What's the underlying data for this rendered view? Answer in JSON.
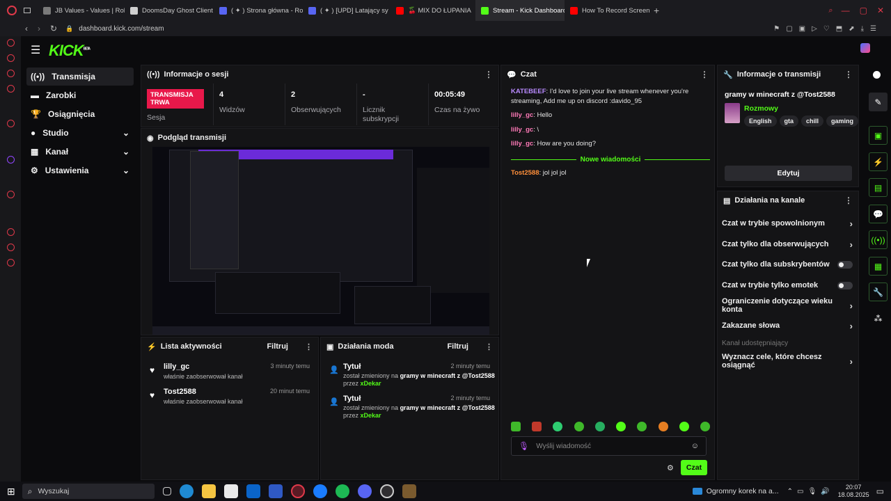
{
  "browser": {
    "tabs": [
      {
        "label": "JB Values - Values | Robl",
        "color": "#7a7a7a"
      },
      {
        "label": "DoomsDay Ghost Client",
        "color": "#cfcfcf"
      },
      {
        "label": "( ✦ ) Strona główna - Rob",
        "color": "#5865f2"
      },
      {
        "label": "( ✦ ) [UPD] Latający sy",
        "color": "#5865f2"
      },
      {
        "label": "🍒 MIX DO ŁUPANIA",
        "color": "#ff0000"
      },
      {
        "label": "Stream - Kick Dashboard",
        "color": "#53fc18"
      },
      {
        "label": "How To Record Screen W",
        "color": "#ff0000"
      }
    ],
    "url": "dashboard.kick.com/stream"
  },
  "app": {
    "logo": "KICK",
    "logo_sup": "BETA"
  },
  "sidebar": {
    "items": [
      {
        "label": "Transmisja"
      },
      {
        "label": "Zarobki"
      },
      {
        "label": "Osiągnięcia"
      },
      {
        "label": "Studio"
      },
      {
        "label": "Kanał"
      },
      {
        "label": "Ustawienia"
      }
    ]
  },
  "session": {
    "title": "Informacje o sesji",
    "live_badge": "TRANSMISJA TRWA",
    "session_label": "Sesja",
    "stats": [
      {
        "value": "4",
        "label": "Widzów"
      },
      {
        "value": "2",
        "label": "Obserwujących"
      },
      {
        "value": "-",
        "label": "Licznik subskrypcji"
      },
      {
        "value": "00:05:49",
        "label": "Czas na żywo"
      }
    ]
  },
  "preview": {
    "title": "Podgląd transmisji"
  },
  "activity": {
    "title": "Lista aktywności",
    "filter": "Filtruj",
    "items": [
      {
        "name": "lilly_gc",
        "desc": "właśnie zaobserwował kanał",
        "time": "3 minuty temu"
      },
      {
        "name": "Tost2588",
        "desc": "właśnie zaobserwował kanał",
        "time": "20 minut temu"
      }
    ]
  },
  "modactions": {
    "title": "Działania moda",
    "filter": "Filtruj",
    "items": [
      {
        "title": "Tytuł",
        "line1": "został zmieniony na",
        "value": "gramy w minecraft z @Tost2588",
        "by": "przez",
        "mod": "xDekar",
        "time": "2 minuty temu"
      },
      {
        "title": "Tytuł",
        "line1": "został zmieniony na",
        "value": "gramy w minecraft z @Tost2588",
        "by": "przez",
        "mod": "xDekar",
        "time": "2 minuty temu"
      }
    ]
  },
  "chat": {
    "title": "Czat",
    "messages": [
      {
        "user": "KATEBEEF",
        "text": "I'd love to join your live stream whenever you're streaming, Add me up on discord :davido_95"
      },
      {
        "user": "lilly_gc",
        "text": "Hello"
      },
      {
        "user": "lilly_gc",
        "text": "\\"
      },
      {
        "user": "lilly_gc",
        "text": "How are you doing?"
      }
    ],
    "new_messages": "Nowe wiadomości",
    "last": {
      "user": "Tost2588",
      "text": "jol jol jol"
    },
    "input_placeholder": "Wyślij wiadomość",
    "send": "Czat"
  },
  "streaminfo": {
    "title": "Informacje o transmisji",
    "stream_title": "gramy w minecraft z @Tost2588",
    "category": "Rozmowy",
    "tags": [
      "English",
      "gta",
      "chill",
      "gaming"
    ],
    "edit": "Edytuj"
  },
  "channelops": {
    "title": "Działania na kanale",
    "items": [
      {
        "label": "Czat w trybie spowolnionym",
        "kind": "chevron"
      },
      {
        "label": "Czat tylko dla obserwujących",
        "kind": "chevron"
      },
      {
        "label": "Czat tylko dla subskrybentów",
        "kind": "toggle"
      },
      {
        "label": "Czat w trybie tylko emotek",
        "kind": "toggle"
      },
      {
        "label": "Ograniczenie dotyczące wieku konta",
        "kind": "chevron"
      },
      {
        "label": "Zakazane słowa",
        "kind": "chevron"
      }
    ],
    "section": "Kanał udostępniający",
    "goals": "Wyznacz cele, które chcesz osiągnąć"
  },
  "taskbar": {
    "search": "Wyszukaj",
    "news": "Ogromny korek na a...",
    "time": "20:07",
    "date": "18.08.2025"
  }
}
